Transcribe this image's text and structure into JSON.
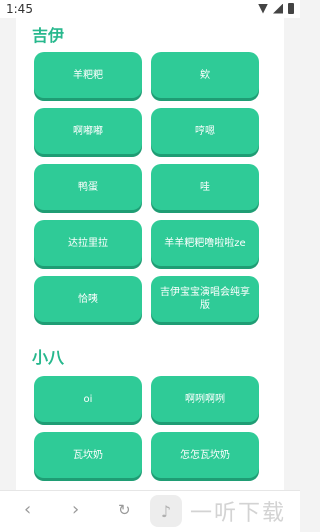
{
  "status_bar": {
    "time": "1:45"
  },
  "sections": [
    {
      "title": "吉伊",
      "buttons": [
        "羊粑粑",
        "欸",
        "啊嘟嘟",
        "哼嗯",
        "鸭蛋",
        "哇",
        "达拉里拉",
        "羊羊粑粑噜啦啦ze",
        "恰咦",
        "吉伊宝宝演唱会纯享版"
      ]
    },
    {
      "title": "小八",
      "buttons": [
        "oi",
        "啊咧啊咧",
        "瓦坎奶",
        "怎怎瓦坎奶"
      ]
    }
  ],
  "nav": {
    "back": "‹",
    "forward": "›",
    "refresh": "↻",
    "watermark_text": "一听下载"
  }
}
